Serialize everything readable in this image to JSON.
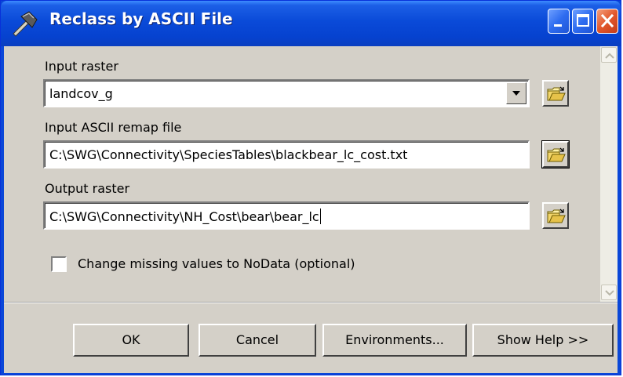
{
  "window": {
    "title": "Reclass by ASCII File"
  },
  "icons": {
    "title_icon": "hammer-icon",
    "minimize": "minimize-icon",
    "maximize": "maximize-icon",
    "close": "close-icon",
    "browse": "open-folder-icon",
    "dropdown": "chevron-down-icon"
  },
  "form": {
    "input_raster": {
      "label": "Input raster",
      "value": "landcov_g"
    },
    "remap_file": {
      "label": "Input ASCII remap file",
      "value": "C:\\SWG\\Connectivity\\SpeciesTables\\blackbear_lc_cost.txt"
    },
    "output_raster": {
      "label": "Output raster",
      "value": "C:\\SWG\\Connectivity\\NH_Cost\\bear\\bear_lc"
    },
    "missing_nodata": {
      "label": "Change missing values to NoData (optional)",
      "checked": false
    }
  },
  "buttons": {
    "ok": "OK",
    "cancel": "Cancel",
    "environments": "Environments...",
    "show_help": "Show Help >>"
  },
  "colors": {
    "titlebar": "#0a4ad8",
    "client_bg": "#d4d0c8",
    "close_button": "#e2572b"
  }
}
